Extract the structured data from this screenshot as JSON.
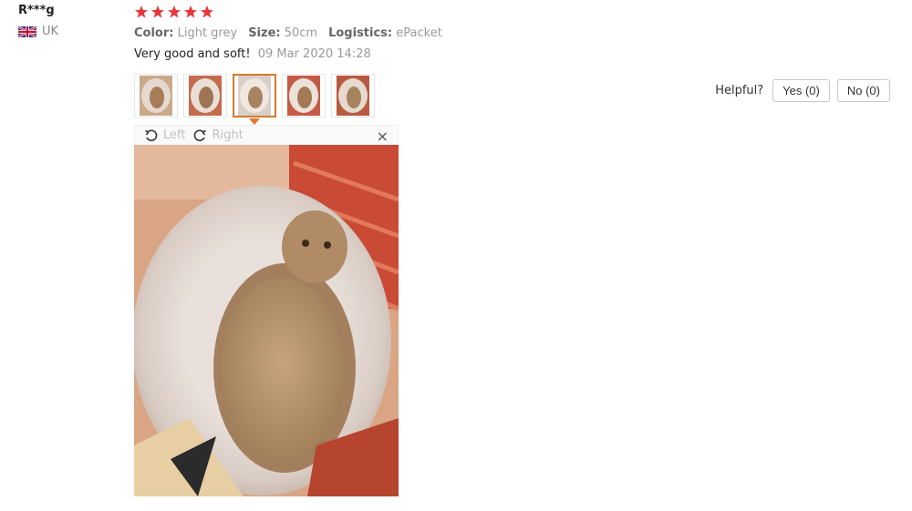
{
  "reviewer": {
    "name": "R***g",
    "country": "UK",
    "flag_icon": "uk-flag-icon"
  },
  "review": {
    "rating": 5,
    "star_color": "#e4393c",
    "color_label": "Color:",
    "color_value": "Light grey",
    "size_label": "Size:",
    "size_value": "50cm",
    "logistics_label": "Logistics:",
    "logistics_value": "ePacket",
    "text": "Very good and soft!",
    "date": "09 Mar 2020 14:28"
  },
  "thumbnails": [
    {
      "name": "review-photo-1"
    },
    {
      "name": "review-photo-2"
    },
    {
      "name": "review-photo-3",
      "active": true
    },
    {
      "name": "review-photo-4"
    },
    {
      "name": "review-photo-5"
    }
  ],
  "helpful": {
    "question": "Helpful?",
    "yes_label": "Yes (0)",
    "no_label": "No (0)"
  },
  "viewer": {
    "rotate_left_label": "Left",
    "rotate_right_label": "Right",
    "close_glyph": "×"
  },
  "colors": {
    "accent": "#e4762b"
  }
}
